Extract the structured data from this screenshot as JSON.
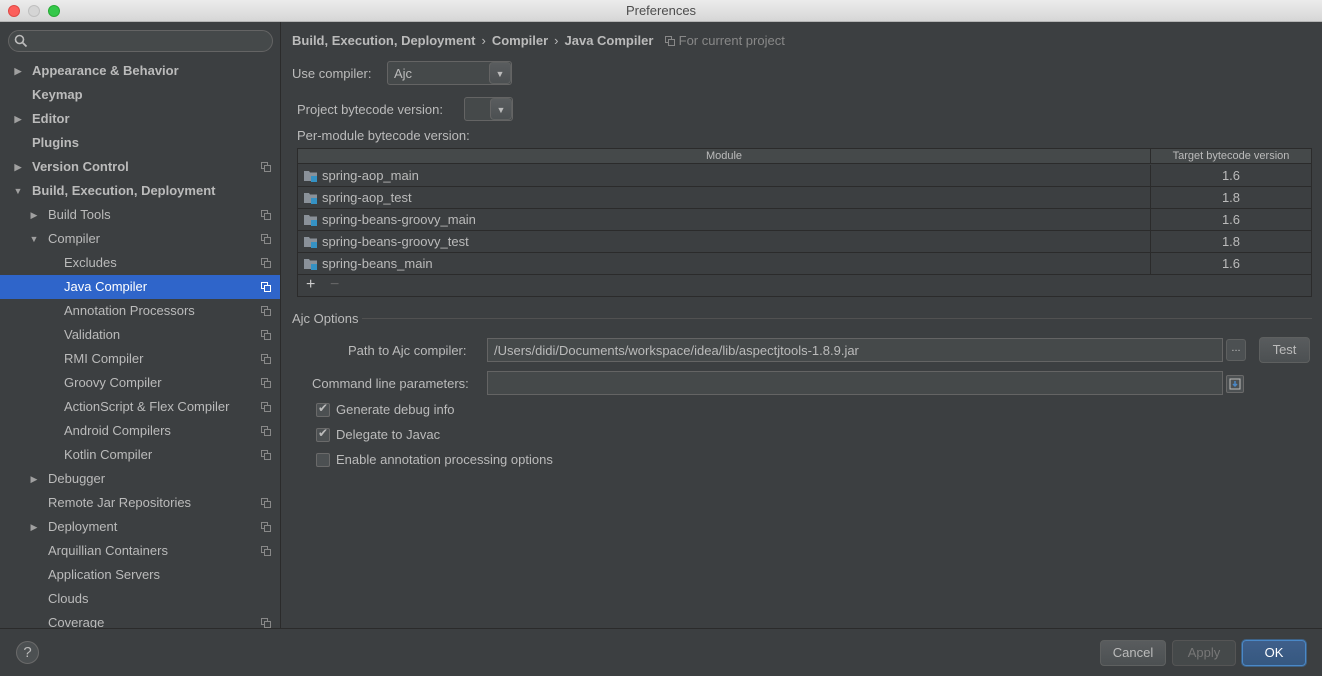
{
  "window": {
    "title": "Preferences"
  },
  "sidebar": {
    "search": {
      "placeholder": ""
    },
    "items": [
      {
        "label": "Appearance & Behavior",
        "level": 0,
        "arrow": "right",
        "bold": true,
        "project": false
      },
      {
        "label": "Keymap",
        "level": 0,
        "arrow": "",
        "bold": true,
        "project": false
      },
      {
        "label": "Editor",
        "level": 0,
        "arrow": "right",
        "bold": true,
        "project": false
      },
      {
        "label": "Plugins",
        "level": 0,
        "arrow": "",
        "bold": true,
        "project": false
      },
      {
        "label": "Version Control",
        "level": 0,
        "arrow": "right",
        "bold": true,
        "project": true
      },
      {
        "label": "Build, Execution, Deployment",
        "level": 0,
        "arrow": "down",
        "bold": true,
        "project": false
      },
      {
        "label": "Build Tools",
        "level": 1,
        "arrow": "right",
        "bold": false,
        "project": true
      },
      {
        "label": "Compiler",
        "level": 1,
        "arrow": "down",
        "bold": false,
        "project": true
      },
      {
        "label": "Excludes",
        "level": 2,
        "arrow": "",
        "bold": false,
        "project": true
      },
      {
        "label": "Java Compiler",
        "level": 2,
        "arrow": "",
        "bold": false,
        "project": true,
        "selected": true
      },
      {
        "label": "Annotation Processors",
        "level": 2,
        "arrow": "",
        "bold": false,
        "project": true
      },
      {
        "label": "Validation",
        "level": 2,
        "arrow": "",
        "bold": false,
        "project": true
      },
      {
        "label": "RMI Compiler",
        "level": 2,
        "arrow": "",
        "bold": false,
        "project": true
      },
      {
        "label": "Groovy Compiler",
        "level": 2,
        "arrow": "",
        "bold": false,
        "project": true
      },
      {
        "label": "ActionScript & Flex Compiler",
        "level": 2,
        "arrow": "",
        "bold": false,
        "project": true
      },
      {
        "label": "Android Compilers",
        "level": 2,
        "arrow": "",
        "bold": false,
        "project": true
      },
      {
        "label": "Kotlin Compiler",
        "level": 2,
        "arrow": "",
        "bold": false,
        "project": true
      },
      {
        "label": "Debugger",
        "level": 1,
        "arrow": "right",
        "bold": false,
        "project": false
      },
      {
        "label": "Remote Jar Repositories",
        "level": 1,
        "arrow": "",
        "bold": false,
        "project": true
      },
      {
        "label": "Deployment",
        "level": 1,
        "arrow": "right",
        "bold": false,
        "project": true
      },
      {
        "label": "Arquillian Containers",
        "level": 1,
        "arrow": "",
        "bold": false,
        "project": true
      },
      {
        "label": "Application Servers",
        "level": 1,
        "arrow": "",
        "bold": false,
        "project": false
      },
      {
        "label": "Clouds",
        "level": 1,
        "arrow": "",
        "bold": false,
        "project": false
      },
      {
        "label": "Coverage",
        "level": 1,
        "arrow": "",
        "bold": false,
        "project": true
      }
    ]
  },
  "breadcrumb": {
    "items": [
      "Build, Execution, Deployment",
      "Compiler",
      "Java Compiler"
    ],
    "separator": "›",
    "project_note": "For current project"
  },
  "compiler": {
    "use_label": "Use compiler:",
    "use_value": "Ajc",
    "bytecode_label": "Project bytecode version:",
    "bytecode_value": "",
    "per_module_label": "Per-module bytecode version:"
  },
  "module_table": {
    "columns": [
      "Module",
      "Target bytecode version"
    ],
    "rows": [
      {
        "module": "spring-aop_main",
        "version": "1.6"
      },
      {
        "module": "spring-aop_test",
        "version": "1.8"
      },
      {
        "module": "spring-beans-groovy_main",
        "version": "1.6"
      },
      {
        "module": "spring-beans-groovy_test",
        "version": "1.8"
      },
      {
        "module": "spring-beans_main",
        "version": "1.6"
      }
    ],
    "add_label": "+",
    "remove_label": "−"
  },
  "ajc": {
    "section_title": "Ajc Options",
    "path_label": "Path to Ajc compiler:",
    "path_value": "/Users/didi/Documents/workspace/idea/lib/aspectjtools-1.8.9.jar",
    "browse_label": "...",
    "test_label": "Test",
    "cmd_label": "Command line parameters:",
    "cmd_value": "",
    "options": [
      {
        "label": "Generate debug info",
        "checked": true
      },
      {
        "label": "Delegate to Javac",
        "checked": true
      },
      {
        "label": "Enable annotation processing options",
        "checked": false
      }
    ]
  },
  "footer": {
    "help_label": "?",
    "cancel_label": "Cancel",
    "apply_label": "Apply",
    "ok_label": "OK"
  },
  "colors": {
    "background": "#3c3f41",
    "selection": "#2f65ca",
    "text": "#bbbbbb",
    "primary_button_border": "#4a88c7"
  }
}
